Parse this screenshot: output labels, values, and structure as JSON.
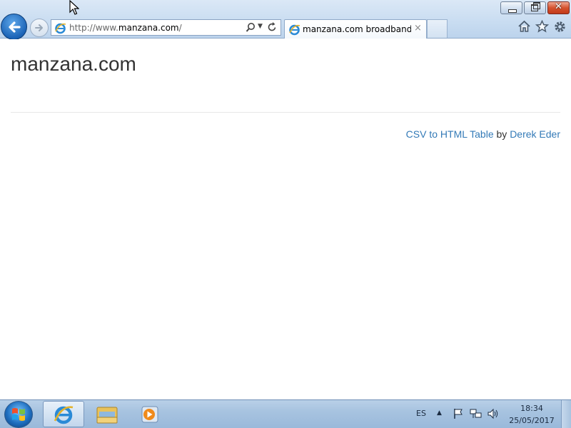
{
  "browser": {
    "address": {
      "prefix": "http://www.",
      "host": "manzana.com",
      "suffix": "/"
    },
    "tabs": [
      {
        "label": "manzana.com broadband ..."
      }
    ],
    "tab_close": "×",
    "window_close": "✕"
  },
  "page": {
    "title": "manzana.com",
    "footer": {
      "link1": "CSV to HTML Table",
      "by": "by",
      "link2": "Derek Eder"
    }
  },
  "taskbar": {
    "language": "ES",
    "time": "18:34",
    "date": "25/05/2017"
  },
  "colors": {
    "link": "#337ab7",
    "title_text": "#333333",
    "taskbar": "#a7c3e0"
  }
}
